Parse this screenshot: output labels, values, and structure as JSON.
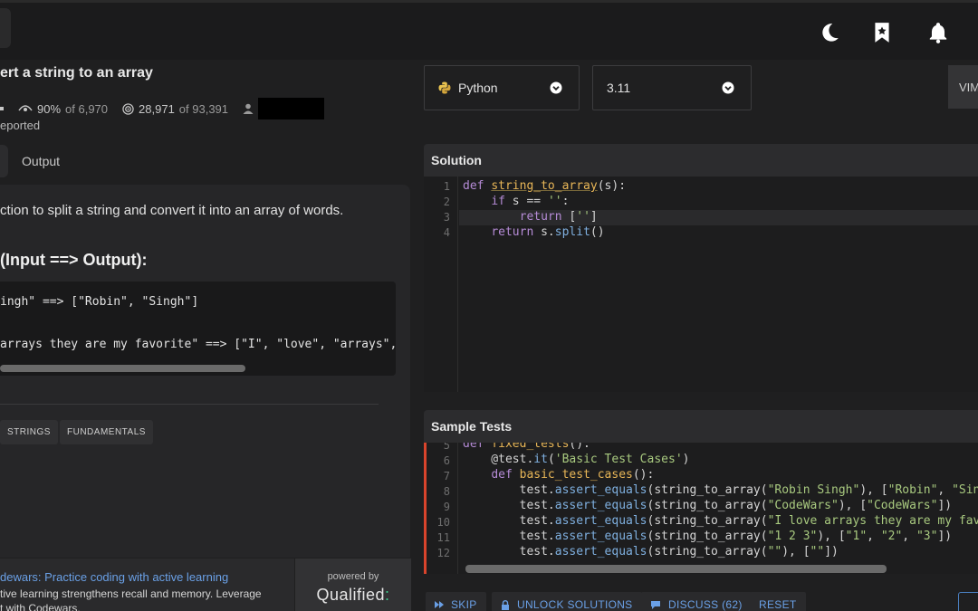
{
  "header": {
    "icons": [
      "moon-icon",
      "bookmark-star-icon",
      "bell-icon"
    ]
  },
  "kata": {
    "title": "ert a string to an array",
    "stats": {
      "satisfaction": "90%",
      "satisfaction_of": "of 6,970",
      "completions": "28,971",
      "completions_of": "of 93,391"
    },
    "reported": "eported",
    "tab_output": "Output"
  },
  "description": {
    "text": "ction to split a string and convert it into an array of words.",
    "heading": "(Input ==> Output):",
    "examples": [
      "ingh\" ==> [\"Robin\", \"Singh\"]",
      "arrays they are my favorite\" ==> [\"I\", \"love\", \"arrays\", \"t"
    ],
    "tags": [
      "STRINGS",
      "FUNDAMENTALS"
    ]
  },
  "ad": {
    "title": "dewars: Practice coding with active learning",
    "body_line1": "tive learning strengthens recall and memory. Leverage",
    "body_line2": "t with Codewars.",
    "powered_by": "powered by",
    "brand": "Qualified",
    "brand_dots": ":"
  },
  "editor_controls": {
    "language": "Python",
    "version": "3.11",
    "mode_label": "VIM"
  },
  "solution": {
    "title": "Solution",
    "line_numbers": [
      "1",
      "2",
      "3",
      "4"
    ]
  },
  "tests": {
    "title": "Sample Tests",
    "line_numbers": [
      "5",
      "6",
      "7",
      "8",
      "9",
      "10",
      "11",
      "12"
    ]
  },
  "actions": {
    "skip": "SKIP",
    "unlock": "UNLOCK SOLUTIONS",
    "discuss": "DISCUSS (62)",
    "reset": "RESET"
  },
  "colors": {
    "background": "#1f1f20",
    "link": "#6aa0e6",
    "keyword": "#b58bd6",
    "function": "#e8b657",
    "string": "#a8c97f",
    "accent_red": "#d9442c",
    "qualified_green": "#3ccf8e"
  }
}
